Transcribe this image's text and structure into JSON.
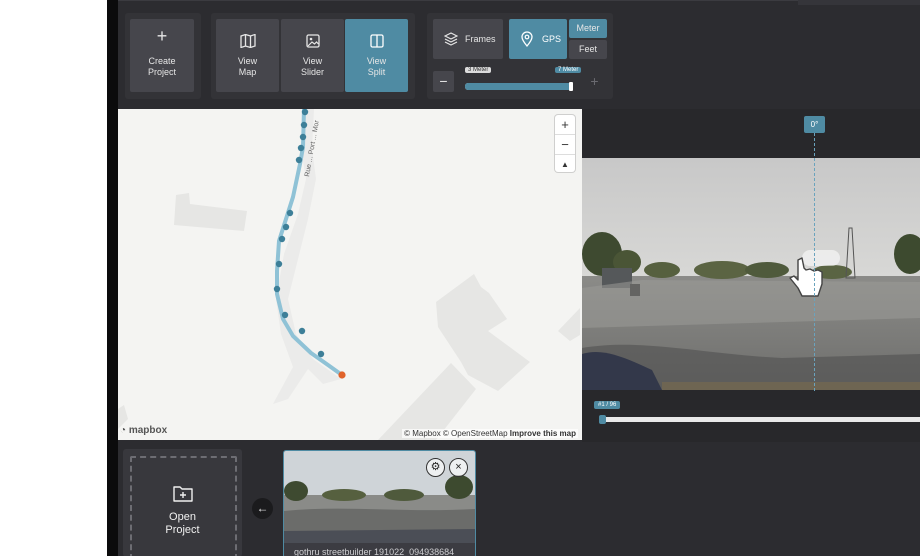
{
  "toolbar": {
    "create_project": "Create\nProject",
    "view_map": "View\nMap",
    "view_slider": "View\nSlider",
    "view_split": "View\nSplit",
    "frames": "Frames",
    "gps": "GPS",
    "meter": "Meter",
    "feet": "Feet",
    "minus": "−",
    "plus": "+",
    "min_label": "3 Meter",
    "value_label": "7 Meter",
    "slider_fill_fraction": 0.97
  },
  "map": {
    "zoom_in": "+",
    "zoom_out": "−",
    "compass": "▲",
    "road_label": "Rue ... Port ... Mor",
    "attribution_mapbox": "© Mapbox",
    "attribution_osm": "© OpenStreetMap",
    "improve": "Improve this map",
    "logo": "mapbox",
    "track_color": "#3d7f98",
    "current_point_color": "#e0632b"
  },
  "viewer": {
    "heading": "0°",
    "frame_counter": "#1 / 96"
  },
  "bottom": {
    "open_project": "Open\nProject",
    "back": "←",
    "thumbnail_caption": "gothru streetbuilder 191022_094938684",
    "settings_icon": "⚙",
    "close_icon": "×"
  },
  "colors": {
    "accent": "#4f8ba3",
    "panel": "#2c2c30",
    "button": "#46464c"
  }
}
